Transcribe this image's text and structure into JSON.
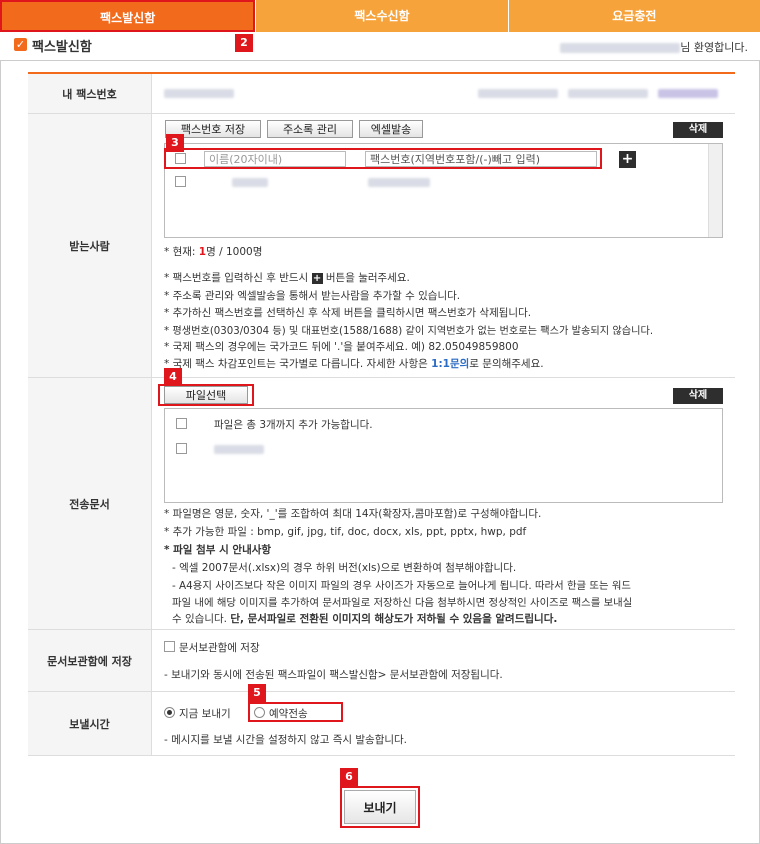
{
  "tabs": [
    {
      "label": "팩스발신함"
    },
    {
      "label": "팩스수신함"
    },
    {
      "label": "요금충전"
    }
  ],
  "header": {
    "title": "팩스발신함",
    "welcome_suffix": "님 환영합니다."
  },
  "badges": {
    "b2": "2",
    "b3": "3",
    "b4": "4",
    "b5": "5",
    "b6": "6"
  },
  "my_fax": {
    "label": "내 팩스번호"
  },
  "recipients": {
    "label": "받는사람",
    "btn_save": "팩스번호 저장",
    "btn_address": "주소록 관리",
    "btn_excel": "엑셀발송",
    "btn_delete": "삭제",
    "name_placeholder": "이름(20자이내)",
    "fax_placeholder": "팩스번호(지역번호포함/(-)빼고 입력)",
    "plus": "+",
    "count_prefix": "* 현재: ",
    "count_current": "1",
    "count_suffix": "명 / 1000명",
    "notes": [
      "* 팩스번호를 입력하신 후 반드시",
      "버튼을 눌러주세요.",
      "* 주소록 관리와 엑셀발송을 통해서 받는사람을 추가할 수 있습니다.",
      "* 추가하신 팩스번호를 선택하신 후 삭제 버튼을 클릭하시면 팩스번호가 삭제됩니다.",
      "* 평생번호(0303/0304 등) 및 대표번호(1588/1688) 같이 지역번호가 없는 번호로는 팩스가 발송되지 않습니다.",
      "* 국제 팩스의 경우에는 국가코드 뒤에 '.'을 붙여주세요. 예) 82.05049859800",
      "* 국제 팩스 차감포인트는 국가별로 다릅니다. 자세한 사항은",
      "1:1문의",
      "로 문의해주세요."
    ]
  },
  "documents": {
    "label": "전송문서",
    "btn_file": "파일선택",
    "btn_delete": "삭제",
    "file_hint": "파일은 총 3개까지 추가 가능합니다.",
    "notes": [
      "* 파일명은 영문, 숫자, '_'를 조합하여 최대 14자(확장자,콤마포함)로 구성해야합니다.",
      "* 추가 가능한 파일 : bmp, gif, jpg, tif, doc, docx, xls, ppt, pptx, hwp, pdf",
      "* 파일 첨부 시 안내사항",
      "- 엑셀 2007문서(.xlsx)의 경우 하위 버전(xls)으로 변환하여 첨부해야합니다.",
      "- A4용지 사이즈보다 작은 이미지 파일의 경우 사이즈가 자동으로 늘어나게 됩니다. 따라서 한글 또는 워드",
      "파일 내에 해당 이미지를 추가하여 문서파일로 저장하신 다음 첨부하시면 정상적인 사이즈로 팩스를 보내실",
      "수 있습니다.",
      "단, 문서파일로 전환된 이미지의 해상도가 저하될 수 있음을 알려드립니다."
    ]
  },
  "archive": {
    "label": "문서보관함에 저장",
    "checkbox_label": "문서보관함에 저장",
    "note": "- 보내기와 동시에 전송된 팩스파일이 팩스발신함> 문서보관함에 저장됩니다."
  },
  "send_time": {
    "label": "보낼시간",
    "option_now": "지금 보내기",
    "option_reserve": "예약전송",
    "selected": "지금 보내기",
    "note": "- 메시지를 보낼 시간을 설정하지 않고 즉시 발송합니다."
  },
  "send_button": "보내기",
  "colors": {
    "accent": "#f26b1d",
    "tab": "#f7a33c",
    "highlight": "#e0161d",
    "link": "#2b6cc4"
  }
}
